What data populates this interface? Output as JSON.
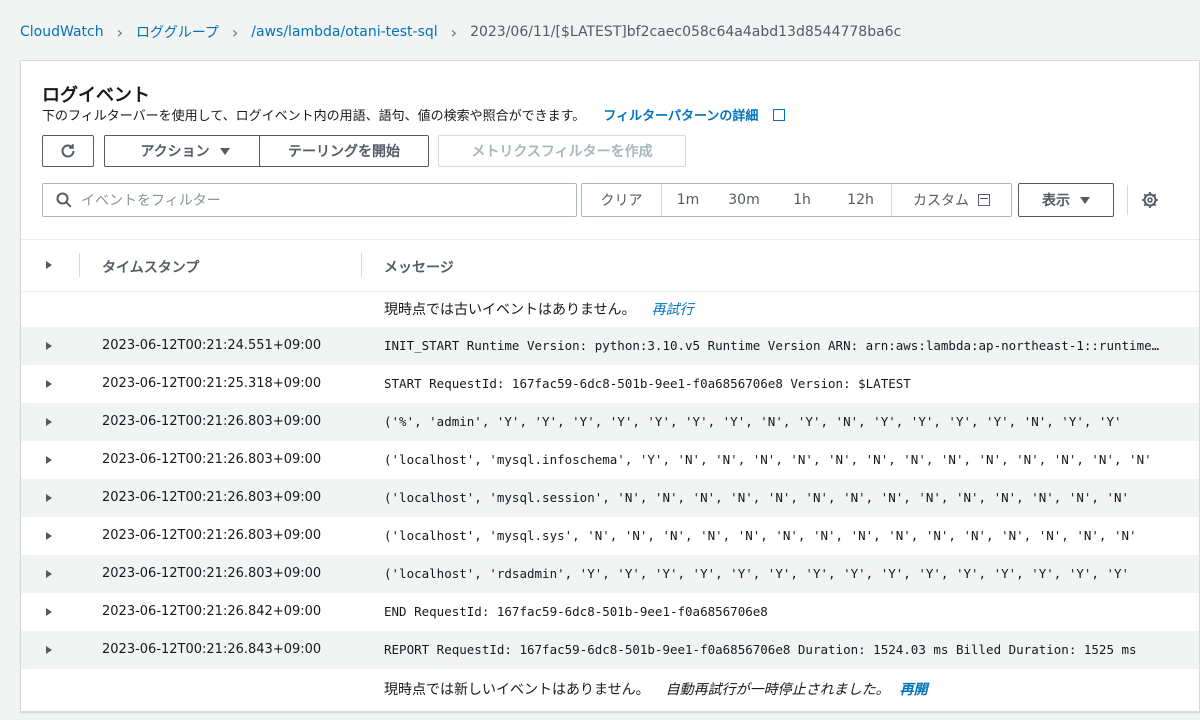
{
  "breadcrumb": {
    "items": [
      "CloudWatch",
      "ロググループ",
      "/aws/lambda/otani-test-sql"
    ],
    "current": "2023/06/11/[$LATEST]bf2caec058c64a4abd13d8544778ba6c"
  },
  "panel": {
    "title": "ログイベント",
    "description": "下のフィルターバーを使用して、ログイベント内の用語、語句、値の検索や照合ができます。",
    "details_link": "フィルターパターンの詳細"
  },
  "toolbar": {
    "actions_label": "アクション",
    "tailing_label": "テーリングを開始",
    "metric_filter_label": "メトリクスフィルターを作成",
    "search_placeholder": "イベントをフィルター",
    "ranges": [
      "クリア",
      "1m",
      "30m",
      "1h",
      "12h"
    ],
    "custom_label": "カスタム",
    "display_label": "表示"
  },
  "table": {
    "headers": [
      "タイムスタンプ",
      "メッセージ"
    ],
    "top_notice": "現時点では古いイベントはありません。",
    "retry_label": "再試行",
    "rows": [
      {
        "timestamp": "2023-06-12T00:21:24.551+09:00",
        "message": "INIT_START Runtime Version: python:3.10.v5 Runtime Version ARN: arn:aws:lambda:ap-northeast-1::runtime:..."
      },
      {
        "timestamp": "2023-06-12T00:21:25.318+09:00",
        "message": "START RequestId: 167fac59-6dc8-501b-9ee1-f0a6856706e8 Version: $LATEST"
      },
      {
        "timestamp": "2023-06-12T00:21:26.803+09:00",
        "message": "('%', 'admin', 'Y', 'Y', 'Y', 'Y', 'Y', 'Y', 'Y', 'N', 'Y', 'N', 'Y', 'Y', 'Y', 'Y', 'N', 'Y', 'Y'"
      },
      {
        "timestamp": "2023-06-12T00:21:26.803+09:00",
        "message": "('localhost', 'mysql.infoschema', 'Y', 'N', 'N', 'N', 'N', 'N', 'N', 'N', 'N', 'N', 'N', 'N', 'N', 'N'"
      },
      {
        "timestamp": "2023-06-12T00:21:26.803+09:00",
        "message": "('localhost', 'mysql.session', 'N', 'N', 'N', 'N', 'N', 'N', 'N', 'N', 'N', 'N', 'N', 'N', 'N', 'N'"
      },
      {
        "timestamp": "2023-06-12T00:21:26.803+09:00",
        "message": "('localhost', 'mysql.sys', 'N', 'N', 'N', 'N', 'N', 'N', 'N', 'N', 'N', 'N', 'N', 'N', 'N', 'N', 'N'"
      },
      {
        "timestamp": "2023-06-12T00:21:26.803+09:00",
        "message": "('localhost', 'rdsadmin', 'Y', 'Y', 'Y', 'Y', 'Y', 'Y', 'Y', 'Y', 'Y', 'Y', 'Y', 'Y', 'Y', 'Y', 'Y'"
      },
      {
        "timestamp": "2023-06-12T00:21:26.842+09:00",
        "message": "END RequestId: 167fac59-6dc8-501b-9ee1-f0a6856706e8"
      },
      {
        "timestamp": "2023-06-12T00:21:26.843+09:00",
        "message": "REPORT RequestId: 167fac59-6dc8-501b-9ee1-f0a6856706e8 Duration: 1524.03 ms Billed Duration: 1525 ms"
      }
    ],
    "bottom_notice": "現時点では新しいイベントはありません。",
    "auto_retry_paused": "自動再試行が一時停止されました。",
    "resume_label": "再開"
  }
}
